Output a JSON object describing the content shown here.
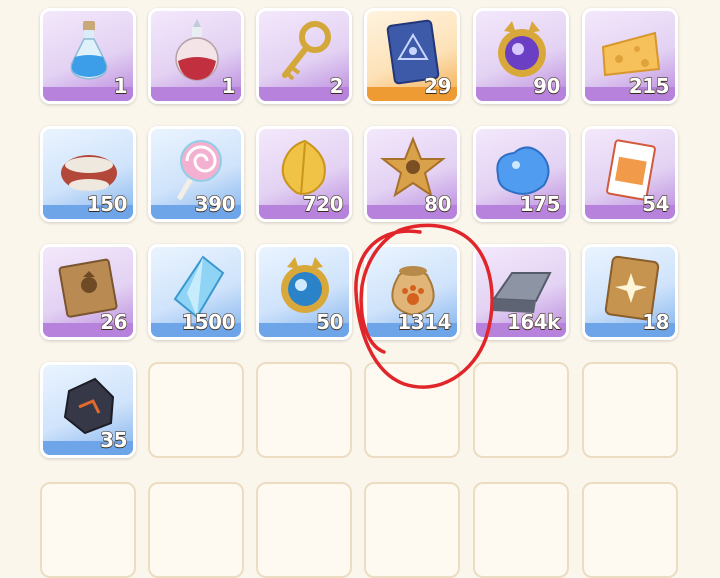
{
  "inventory": {
    "items": [
      {
        "icon": "blue-potion-icon",
        "count": "1",
        "rarity": "purple"
      },
      {
        "icon": "red-potion-icon",
        "count": "1",
        "rarity": "purple"
      },
      {
        "icon": "golden-key-icon",
        "count": "2",
        "rarity": "purple"
      },
      {
        "icon": "eye-card-icon",
        "count": "29",
        "rarity": "orange"
      },
      {
        "icon": "cat-mirror-purple-icon",
        "count": "90",
        "rarity": "purple"
      },
      {
        "icon": "cheese-icon",
        "count": "215",
        "rarity": "purple"
      },
      {
        "icon": "fur-pouch-icon",
        "count": "150",
        "rarity": "blue"
      },
      {
        "icon": "lollipop-icon",
        "count": "390",
        "rarity": "blue"
      },
      {
        "icon": "golden-leaf-icon",
        "count": "720",
        "rarity": "purple"
      },
      {
        "icon": "star-cookie-icon",
        "count": "80",
        "rarity": "purple"
      },
      {
        "icon": "blue-slime-icon",
        "count": "175",
        "rarity": "purple"
      },
      {
        "icon": "ticket-icon",
        "count": "54",
        "rarity": "purple"
      },
      {
        "icon": "cat-book-icon",
        "count": "26",
        "rarity": "purple"
      },
      {
        "icon": "blue-crystal-icon",
        "count": "1500",
        "rarity": "blue"
      },
      {
        "icon": "cat-mirror-blue-icon",
        "count": "50",
        "rarity": "blue"
      },
      {
        "icon": "paw-sack-icon",
        "count": "1314",
        "rarity": "blue"
      },
      {
        "icon": "metal-ingot-icon",
        "count": "164k",
        "rarity": "purple"
      },
      {
        "icon": "star-card-icon",
        "count": "18",
        "rarity": "blue"
      },
      {
        "icon": "dark-ore-icon",
        "count": "35",
        "rarity": "blue"
      }
    ],
    "empty_slots": 5,
    "partial_row_slots": 6
  },
  "colors": {
    "background": "#fbf6ec",
    "purple_rarity": "#b782dc",
    "blue_rarity": "#6ea4e8",
    "orange_rarity": "#ef9b34",
    "annotation_red": "#e0262a"
  }
}
